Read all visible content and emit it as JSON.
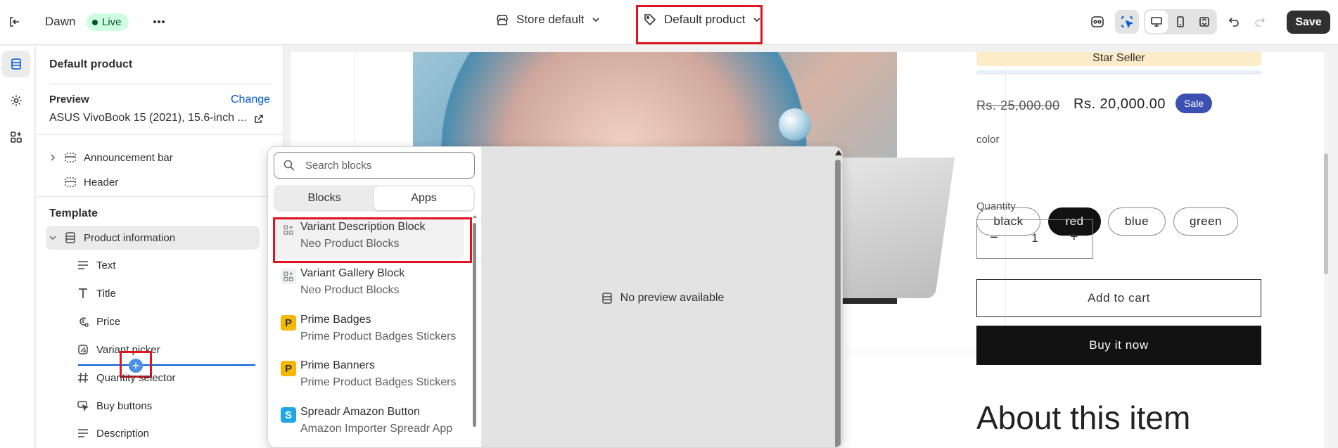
{
  "topbar": {
    "theme_name": "Dawn",
    "live_label": "Live",
    "store_selector": "Store default",
    "template_selector": "Default product",
    "save_label": "Save"
  },
  "sidebar": {
    "title": "Default product",
    "preview_label": "Preview",
    "change_link": "Change",
    "preview_product": "ASUS VivoBook 15 (2021), 15.6-inch ...",
    "header_sections": [
      "Announcement bar",
      "Header"
    ],
    "template_label": "Template",
    "section_name": "Product information",
    "blocks": [
      "Text",
      "Title",
      "Price",
      "Variant picker",
      "Quantity selector",
      "Buy buttons",
      "Description"
    ]
  },
  "block_picker": {
    "search_placeholder": "Search blocks",
    "tabs": [
      "Blocks",
      "Apps"
    ],
    "active_tab": "Apps",
    "items": [
      {
        "name": "Variant Description Block",
        "app": "Neo Product Blocks",
        "icon": "grid-icon"
      },
      {
        "name": "Variant Gallery Block",
        "app": "Neo Product Blocks",
        "icon": "grid-icon"
      },
      {
        "name": "Prime Badges",
        "app": "Prime Product Badges Stickers",
        "icon": "P"
      },
      {
        "name": "Prime Banners",
        "app": "Prime Product Badges Stickers",
        "icon": "P"
      },
      {
        "name": "Spreadr Amazon Button",
        "app": "Amazon Importer Spreadr App",
        "icon": "S"
      }
    ],
    "no_preview": "No preview available"
  },
  "product": {
    "badge": "Star Seller",
    "compare_price": "Rs. 25,000.00",
    "price": "Rs. 20,000.00",
    "sale_badge": "Sale",
    "color_label": "color",
    "colors": [
      "black",
      "red",
      "blue",
      "green"
    ],
    "selected_color": "red",
    "quantity_label": "Quantity",
    "quantity_value": "1",
    "add_to_cart": "Add to cart",
    "buy_now": "Buy it now",
    "about_heading": "About this item"
  },
  "colors": {
    "accent": "#005bd3",
    "highlight": "#e0141e",
    "sale_badge": "#3c4fb3",
    "live_bg": "#cdfee1",
    "prime_icon": "#f5b800",
    "spreadr_icon": "#1ea7e8"
  }
}
